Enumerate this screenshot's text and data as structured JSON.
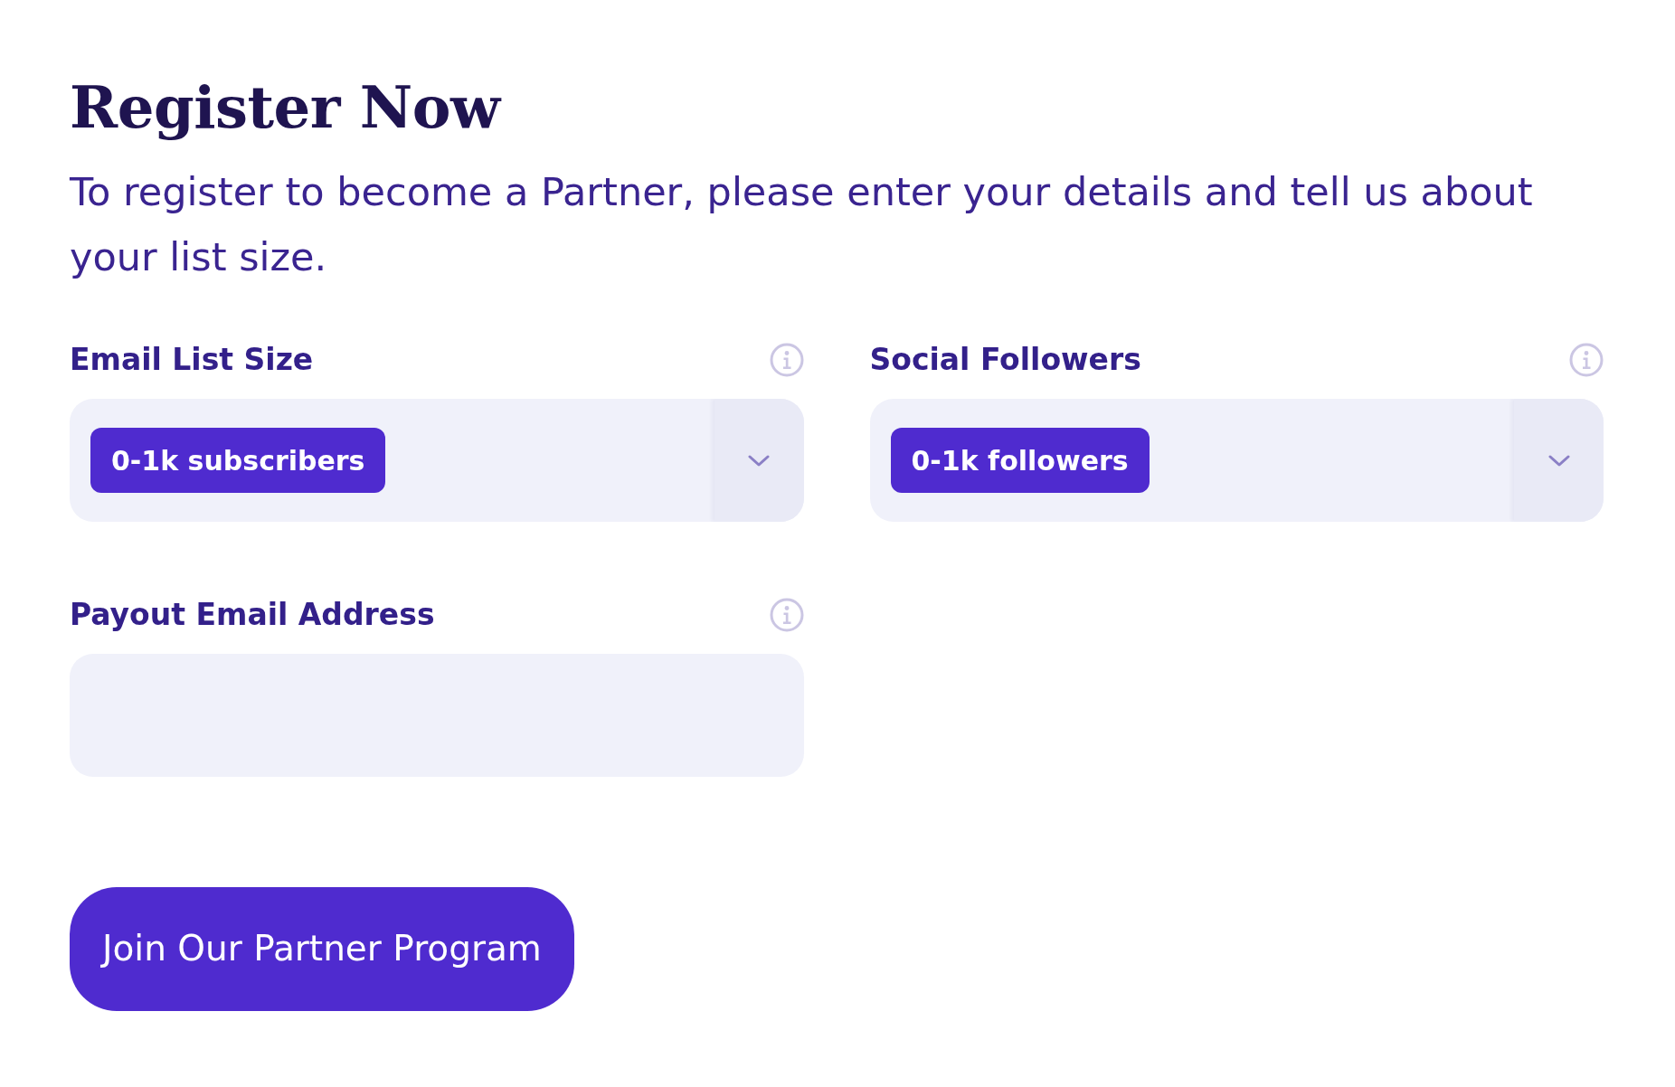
{
  "title": "Register Now",
  "intro": "To register to become a Partner, please enter your details and tell us about your list size.",
  "fields": [
    {
      "kind": "select",
      "label": "Email List Size",
      "value": "0-1k subscribers"
    },
    {
      "kind": "select",
      "label": "Social Followers",
      "value": "0-1k followers"
    },
    {
      "kind": "text",
      "label": "Payout Email Address"
    }
  ],
  "submit_button": "Join Our Partner Program"
}
